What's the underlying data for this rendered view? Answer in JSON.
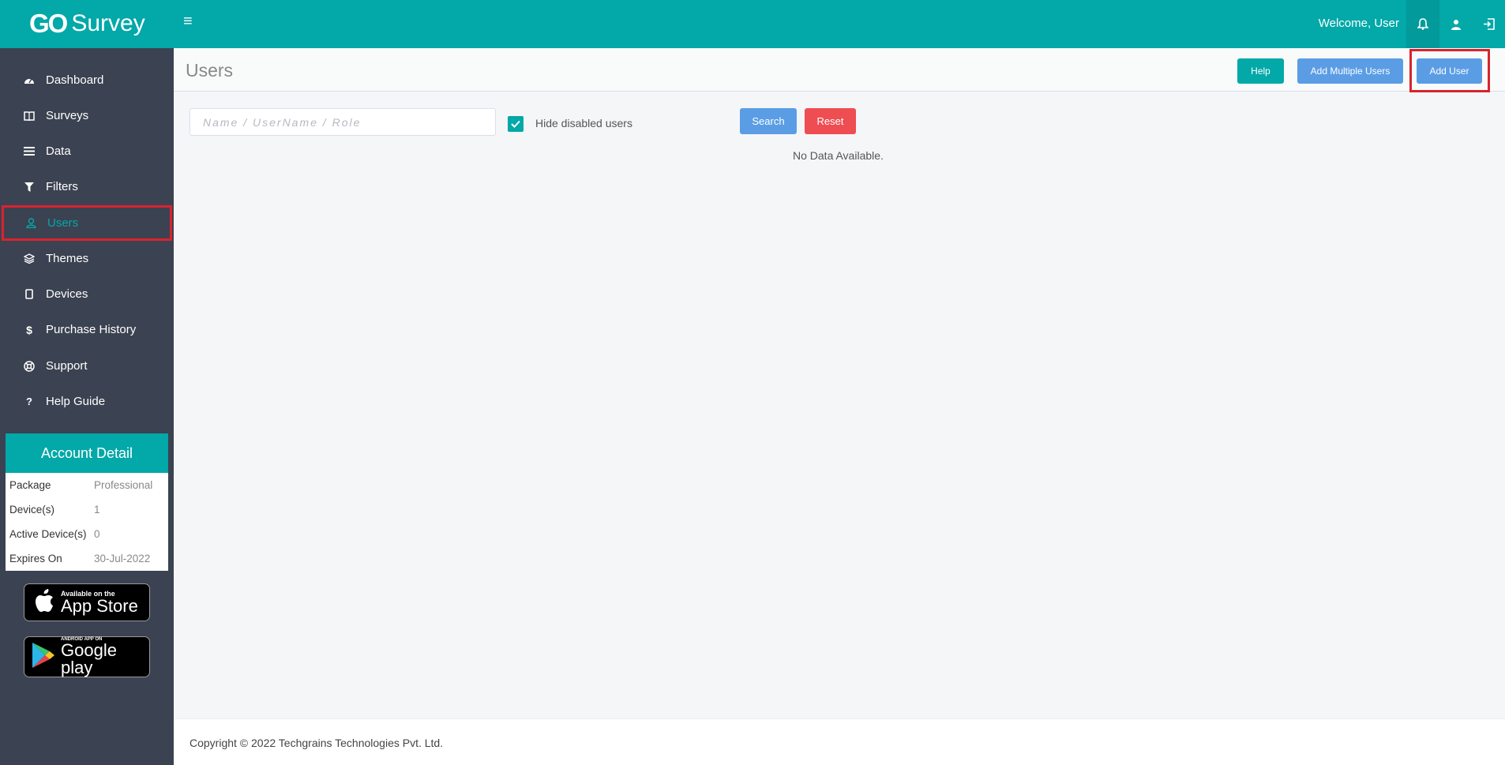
{
  "header": {
    "logo_mark": "GO",
    "logo_text": "Survey",
    "menu_icon": "hamburger-icon",
    "welcome": "Welcome, User",
    "icons": [
      "bell-icon",
      "user-icon",
      "logout-icon"
    ]
  },
  "sidebar": {
    "items": [
      {
        "label": "Dashboard",
        "icon": "dashboard-icon"
      },
      {
        "label": "Surveys",
        "icon": "book-icon"
      },
      {
        "label": "Data",
        "icon": "list-icon"
      },
      {
        "label": "Filters",
        "icon": "filter-icon"
      },
      {
        "label": "Users",
        "icon": "user-icon",
        "active": true
      },
      {
        "label": "Themes",
        "icon": "layers-icon"
      },
      {
        "label": "Devices",
        "icon": "tablet-icon"
      },
      {
        "label": "Purchase History",
        "icon": "dollar-icon"
      },
      {
        "label": "Support",
        "icon": "lifebuoy-icon"
      },
      {
        "label": "Help Guide",
        "icon": "question-icon"
      }
    ],
    "account": {
      "title": "Account Detail",
      "rows": [
        {
          "key": "Package",
          "value": "Professional"
        },
        {
          "key": "Device(s)",
          "value": "1"
        },
        {
          "key": "Active Device(s)",
          "value": "0"
        },
        {
          "key": "Expires On",
          "value": "30-Jul-2022"
        }
      ]
    },
    "app_store": {
      "small": "Available on the",
      "big": "App Store"
    },
    "google_play": {
      "small": "ANDROID APP ON",
      "big": "Google play"
    }
  },
  "page": {
    "title": "Users",
    "help_label": "Help",
    "add_multiple_label": "Add Multiple Users",
    "add_user_label": "Add User",
    "search_placeholder": "Name / UserName / Role",
    "hide_disabled_label": "Hide disabled users",
    "hide_disabled_checked": true,
    "search_label": "Search",
    "reset_label": "Reset",
    "empty_message": "No Data Available."
  },
  "footer": {
    "copyright": "Copyright © 2022 Techgrains Technologies Pvt. Ltd."
  },
  "colors": {
    "brand": "#03a8a8",
    "sidebar_bg": "#3b4251",
    "primary_button": "#5b9de5",
    "danger_button": "#ee4d52",
    "highlight": "#d9232e"
  }
}
